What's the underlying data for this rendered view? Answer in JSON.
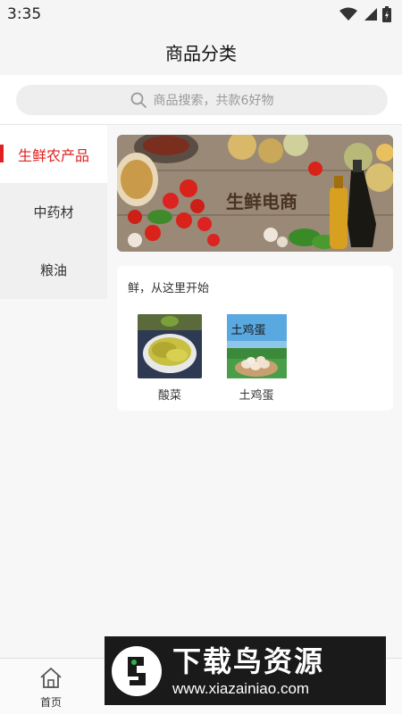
{
  "status_bar": {
    "time": "3:35"
  },
  "header": {
    "title": "商品分类"
  },
  "search": {
    "placeholder": "商品搜索，共款6好物"
  },
  "sidebar": {
    "items": [
      {
        "label": "生鲜农产品",
        "active": true
      },
      {
        "label": "中药材",
        "active": false
      },
      {
        "label": "粮油",
        "active": false
      }
    ]
  },
  "banner": {
    "text": "生鲜电商"
  },
  "section": {
    "title": "鲜，从这里开始",
    "products": [
      {
        "name": "酸菜"
      },
      {
        "name": "土鸡蛋",
        "image_text": "土鸡蛋"
      }
    ]
  },
  "tabbar": {
    "items": [
      {
        "label": "首页",
        "icon": "home-icon"
      }
    ]
  },
  "watermark": {
    "title": "下载鸟资源",
    "url": "www.xiazainiao.com"
  },
  "colors": {
    "accent": "#e02020",
    "background": "#f7f7f7"
  }
}
